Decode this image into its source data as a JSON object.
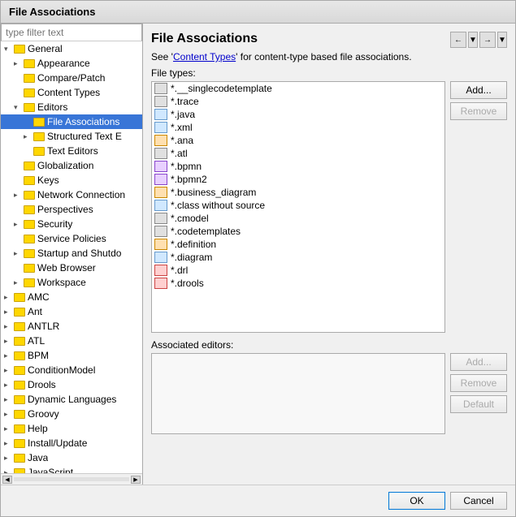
{
  "dialog": {
    "title": "File Associations"
  },
  "filter": {
    "placeholder": "type filter text"
  },
  "nav": {
    "back_title": "Back",
    "forward_title": "Forward",
    "dropdown_title": "Dropdown"
  },
  "left_tree": {
    "items": [
      {
        "id": "general",
        "label": "General",
        "indent": 1,
        "type": "expandable",
        "expanded": true
      },
      {
        "id": "appearance",
        "label": "Appearance",
        "indent": 2,
        "type": "expandable",
        "expanded": false
      },
      {
        "id": "compare-patch",
        "label": "Compare/Patch",
        "indent": 2,
        "type": "leaf"
      },
      {
        "id": "content-types",
        "label": "Content Types",
        "indent": 2,
        "type": "leaf"
      },
      {
        "id": "editors",
        "label": "Editors",
        "indent": 2,
        "type": "expandable",
        "expanded": true
      },
      {
        "id": "file-associations",
        "label": "File Associations",
        "indent": 3,
        "type": "leaf",
        "selected": true
      },
      {
        "id": "structured-text",
        "label": "Structured Text E",
        "indent": 3,
        "type": "expandable"
      },
      {
        "id": "text-editors",
        "label": "Text Editors",
        "indent": 3,
        "type": "leaf"
      },
      {
        "id": "globalization",
        "label": "Globalization",
        "indent": 2,
        "type": "leaf"
      },
      {
        "id": "keys",
        "label": "Keys",
        "indent": 2,
        "type": "leaf"
      },
      {
        "id": "network-connections",
        "label": "Network Connection",
        "indent": 2,
        "type": "expandable"
      },
      {
        "id": "perspectives",
        "label": "Perspectives",
        "indent": 2,
        "type": "leaf"
      },
      {
        "id": "security",
        "label": "Security",
        "indent": 2,
        "type": "expandable",
        "expanded": false
      },
      {
        "id": "service-policies",
        "label": "Service Policies",
        "indent": 2,
        "type": "leaf"
      },
      {
        "id": "startup-shutdown",
        "label": "Startup and Shutdo",
        "indent": 2,
        "type": "expandable"
      },
      {
        "id": "web-browser",
        "label": "Web Browser",
        "indent": 2,
        "type": "leaf"
      },
      {
        "id": "workspace",
        "label": "Workspace",
        "indent": 2,
        "type": "expandable"
      },
      {
        "id": "amc",
        "label": "AMC",
        "indent": 1,
        "type": "expandable"
      },
      {
        "id": "ant",
        "label": "Ant",
        "indent": 1,
        "type": "expandable"
      },
      {
        "id": "antlr",
        "label": "ANTLR",
        "indent": 1,
        "type": "expandable"
      },
      {
        "id": "atl",
        "label": "ATL",
        "indent": 1,
        "type": "expandable"
      },
      {
        "id": "bpm",
        "label": "BPM",
        "indent": 1,
        "type": "expandable"
      },
      {
        "id": "condition-model",
        "label": "ConditionModel",
        "indent": 1,
        "type": "expandable"
      },
      {
        "id": "drools",
        "label": "Drools",
        "indent": 1,
        "type": "expandable"
      },
      {
        "id": "dynamic-languages",
        "label": "Dynamic Languages",
        "indent": 1,
        "type": "expandable"
      },
      {
        "id": "groovy",
        "label": "Groovy",
        "indent": 1,
        "type": "expandable"
      },
      {
        "id": "help",
        "label": "Help",
        "indent": 1,
        "type": "expandable"
      },
      {
        "id": "install-update",
        "label": "Install/Update",
        "indent": 1,
        "type": "expandable"
      },
      {
        "id": "java",
        "label": "Java",
        "indent": 1,
        "type": "expandable"
      },
      {
        "id": "javascript",
        "label": "JavaScript",
        "indent": 1,
        "type": "expandable"
      }
    ]
  },
  "right": {
    "page_title": "File Associations",
    "description": "See 'Content Types' for content-type based file associations.",
    "content_types_link": "Content Types",
    "file_types_label": "File types:",
    "file_items": [
      {
        "label": "*.__singlecodetemplate",
        "icon_type": "gray"
      },
      {
        "label": "*.trace",
        "icon_type": "gray"
      },
      {
        "label": "*.java",
        "icon_type": "blue"
      },
      {
        "label": "*.xml",
        "icon_type": "blue"
      },
      {
        "label": "*.ana",
        "icon_type": "orange"
      },
      {
        "label": "*.atl",
        "icon_type": "gray"
      },
      {
        "label": "*.bpmn",
        "icon_type": "purple"
      },
      {
        "label": "*.bpmn2",
        "icon_type": "purple"
      },
      {
        "label": "*.business_diagram",
        "icon_type": "orange"
      },
      {
        "label": "*.class without source",
        "icon_type": "blue"
      },
      {
        "label": "*.cmodel",
        "icon_type": "gray"
      },
      {
        "label": "*.codetemplates",
        "icon_type": "gray"
      },
      {
        "label": "*.definition",
        "icon_type": "orange"
      },
      {
        "label": "*.diagram",
        "icon_type": "blue"
      },
      {
        "label": "*.drl",
        "icon_type": "red"
      },
      {
        "label": "*.drools",
        "icon_type": "red"
      }
    ],
    "add_file_label": "Add...",
    "remove_file_label": "Remove",
    "associated_editors_label": "Associated editors:",
    "add_editor_label": "Add...",
    "remove_editor_label": "Remove",
    "default_label": "Default"
  },
  "footer": {
    "ok_label": "OK",
    "cancel_label": "Cancel"
  }
}
